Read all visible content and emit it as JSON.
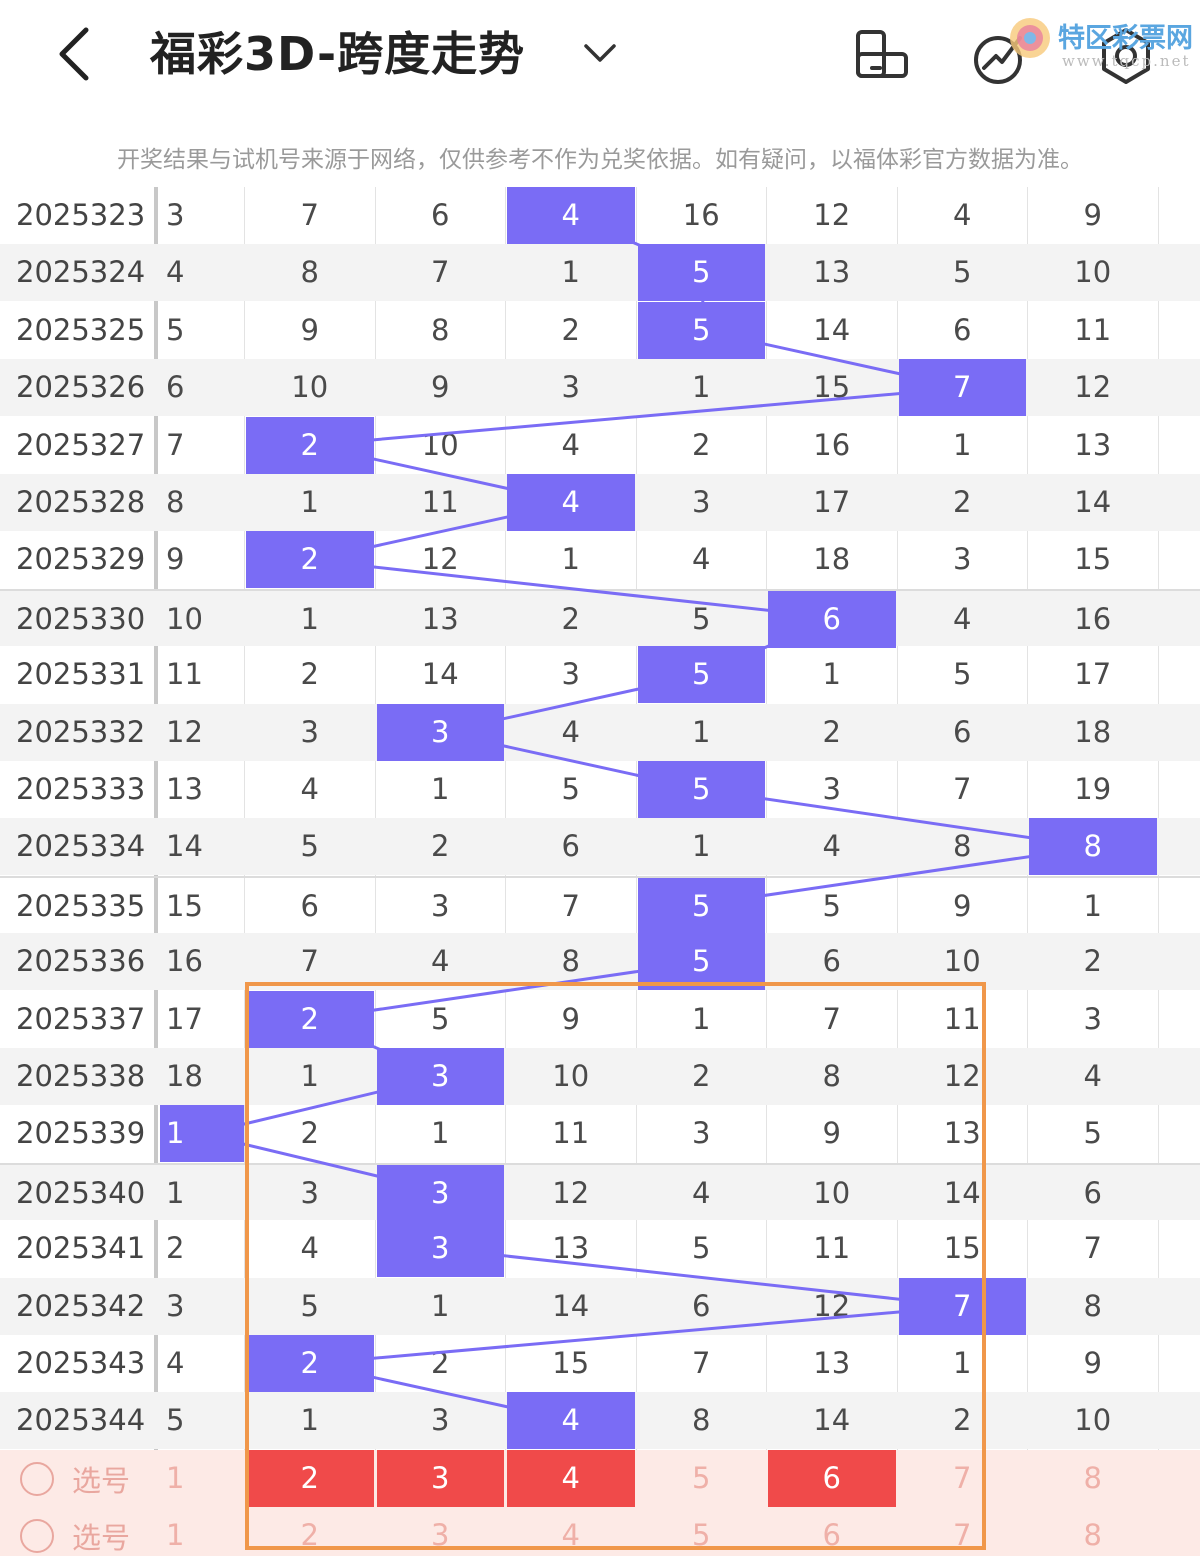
{
  "header": {
    "title": "福彩3D-跨度走势",
    "watermark_text": "特区彩票网",
    "watermark_sub": "www.tqcp.net"
  },
  "notice": "开奖结果与试机号来源于网络，仅供参考不作为兑奖依据。如有疑问，以福体彩官方数据为准。",
  "accent_color": "#7a6cf5",
  "selected_color": "#f04a4a",
  "highlight_box_color": "#f0974a",
  "rows": [
    {
      "issue": "2025323",
      "omit": "3",
      "cells": [
        "7",
        "6",
        "4",
        "16",
        "12",
        "4",
        "9"
      ],
      "hit": 3
    },
    {
      "issue": "2025324",
      "omit": "4",
      "cells": [
        "8",
        "7",
        "1",
        "5",
        "13",
        "5",
        "10"
      ],
      "hit": 4
    },
    {
      "issue": "2025325",
      "omit": "5",
      "cells": [
        "9",
        "8",
        "2",
        "5",
        "14",
        "6",
        "11"
      ],
      "hit": 4
    },
    {
      "issue": "2025326",
      "omit": "6",
      "cells": [
        "10",
        "9",
        "3",
        "1",
        "15",
        "7",
        "12"
      ],
      "hit": 6
    },
    {
      "issue": "2025327",
      "omit": "7",
      "cells": [
        "2",
        "10",
        "4",
        "2",
        "16",
        "1",
        "13"
      ],
      "hit": 1
    },
    {
      "issue": "2025328",
      "omit": "8",
      "cells": [
        "1",
        "11",
        "4",
        "3",
        "17",
        "2",
        "14"
      ],
      "hit": 3
    },
    {
      "issue": "2025329",
      "omit": "9",
      "cells": [
        "2",
        "12",
        "1",
        "4",
        "18",
        "3",
        "15"
      ],
      "hit": 1
    },
    {
      "issue": "2025330",
      "omit": "10",
      "cells": [
        "1",
        "13",
        "2",
        "5",
        "6",
        "4",
        "16"
      ],
      "hit": 5
    },
    {
      "issue": "2025331",
      "omit": "11",
      "cells": [
        "2",
        "14",
        "3",
        "5",
        "1",
        "5",
        "17"
      ],
      "hit": 4
    },
    {
      "issue": "2025332",
      "omit": "12",
      "cells": [
        "3",
        "3",
        "4",
        "1",
        "2",
        "6",
        "18"
      ],
      "hit": 2
    },
    {
      "issue": "2025333",
      "omit": "13",
      "cells": [
        "4",
        "1",
        "5",
        "5",
        "3",
        "7",
        "19"
      ],
      "hit": 4
    },
    {
      "issue": "2025334",
      "omit": "14",
      "cells": [
        "5",
        "2",
        "6",
        "1",
        "4",
        "8",
        "8"
      ],
      "hit": 7
    },
    {
      "issue": "2025335",
      "omit": "15",
      "cells": [
        "6",
        "3",
        "7",
        "5",
        "5",
        "9",
        "1"
      ],
      "hit": 4
    },
    {
      "issue": "2025336",
      "omit": "16",
      "cells": [
        "7",
        "4",
        "8",
        "5",
        "6",
        "10",
        "2"
      ],
      "hit": 4
    },
    {
      "issue": "2025337",
      "omit": "17",
      "cells": [
        "2",
        "5",
        "9",
        "1",
        "7",
        "11",
        "3"
      ],
      "hit": 1
    },
    {
      "issue": "2025338",
      "omit": "18",
      "cells": [
        "1",
        "3",
        "10",
        "2",
        "8",
        "12",
        "4"
      ],
      "hit": 2
    },
    {
      "issue": "2025339",
      "omit": "1",
      "cells": [
        "2",
        "1",
        "11",
        "3",
        "9",
        "13",
        "5"
      ],
      "hit": 0
    },
    {
      "issue": "2025340",
      "omit": "1",
      "cells": [
        "3",
        "3",
        "12",
        "4",
        "10",
        "14",
        "6"
      ],
      "hit": 2
    },
    {
      "issue": "2025341",
      "omit": "2",
      "cells": [
        "4",
        "3",
        "13",
        "5",
        "11",
        "15",
        "7"
      ],
      "hit": 2
    },
    {
      "issue": "2025342",
      "omit": "3",
      "cells": [
        "5",
        "1",
        "14",
        "6",
        "12",
        "7",
        "8"
      ],
      "hit": 6
    },
    {
      "issue": "2025343",
      "omit": "4",
      "cells": [
        "2",
        "2",
        "15",
        "7",
        "13",
        "1",
        "9"
      ],
      "hit": 1
    },
    {
      "issue": "2025344",
      "omit": "5",
      "cells": [
        "1",
        "3",
        "4",
        "8",
        "14",
        "2",
        "10"
      ],
      "hit": 3
    }
  ],
  "pick_rows": [
    {
      "label": "选号",
      "values": [
        "1",
        "2",
        "3",
        "4",
        "5",
        "6",
        "7",
        "8"
      ],
      "selected": [
        1,
        2,
        3,
        5
      ]
    },
    {
      "label": "选号",
      "values": [
        "1",
        "2",
        "3",
        "4",
        "5",
        "6",
        "7",
        "8"
      ],
      "selected": []
    }
  ]
}
